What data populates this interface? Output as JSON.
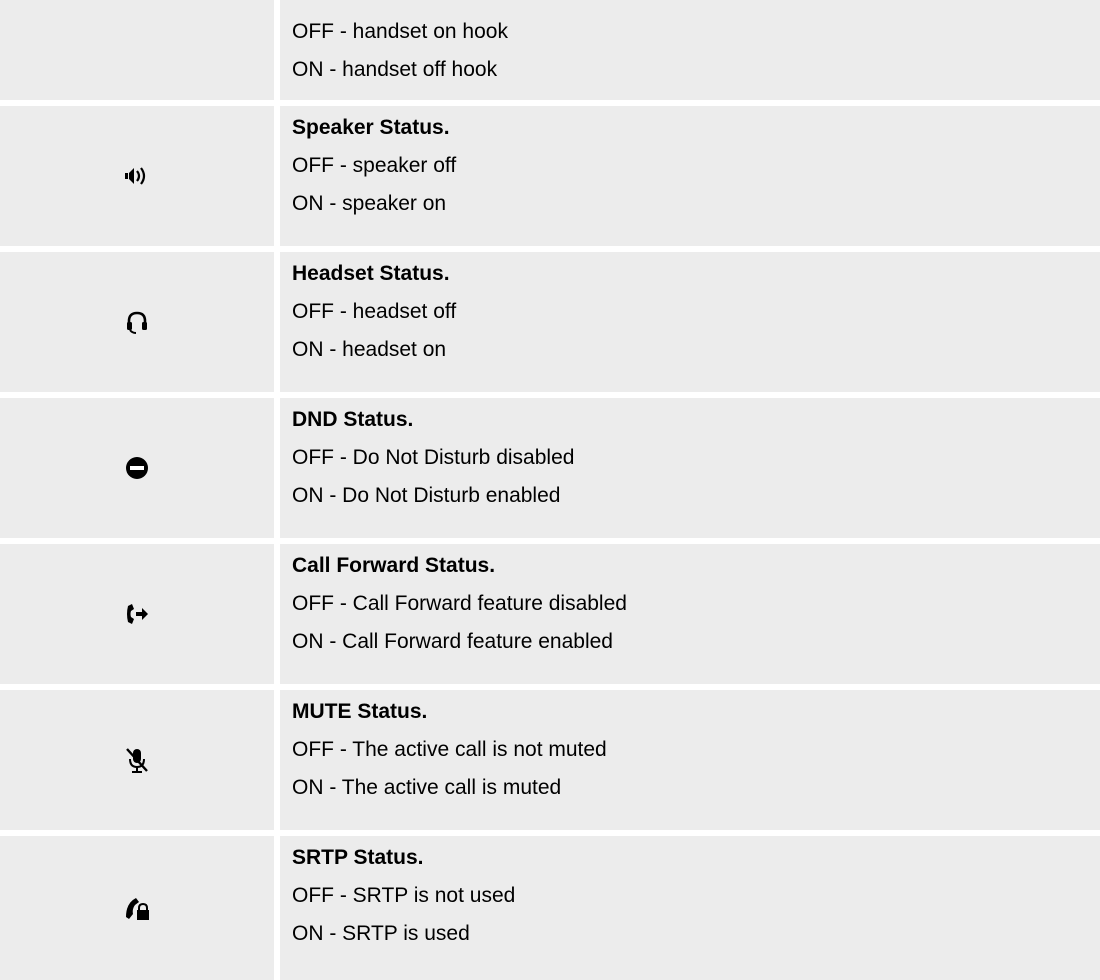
{
  "rows": [
    {
      "icon": "",
      "heading": "",
      "off": "OFF - handset on hook",
      "on": "ON - handset off hook"
    },
    {
      "icon": "speaker-icon",
      "heading": "Speaker Status.",
      "off": "OFF - speaker off",
      "on": "ON - speaker on"
    },
    {
      "icon": "headset-icon",
      "heading": "Headset Status.",
      "off": "OFF - headset off",
      "on": "ON - headset on"
    },
    {
      "icon": "dnd-icon",
      "heading": "DND Status.",
      "off": "OFF - Do Not Disturb disabled",
      "on": "ON - Do Not Disturb enabled"
    },
    {
      "icon": "call-forward-icon",
      "heading": "Call Forward Status.",
      "off": "OFF - Call Forward feature disabled",
      "on": "ON - Call Forward feature enabled"
    },
    {
      "icon": "mute-icon",
      "heading": "MUTE Status.",
      "off": "OFF - The active call is not muted",
      "on": "ON - The active call is muted"
    },
    {
      "icon": "srtp-lock-icon",
      "heading": "SRTP Status.",
      "off": "OFF - SRTP is not used",
      "on": "ON - SRTP is used"
    }
  ]
}
